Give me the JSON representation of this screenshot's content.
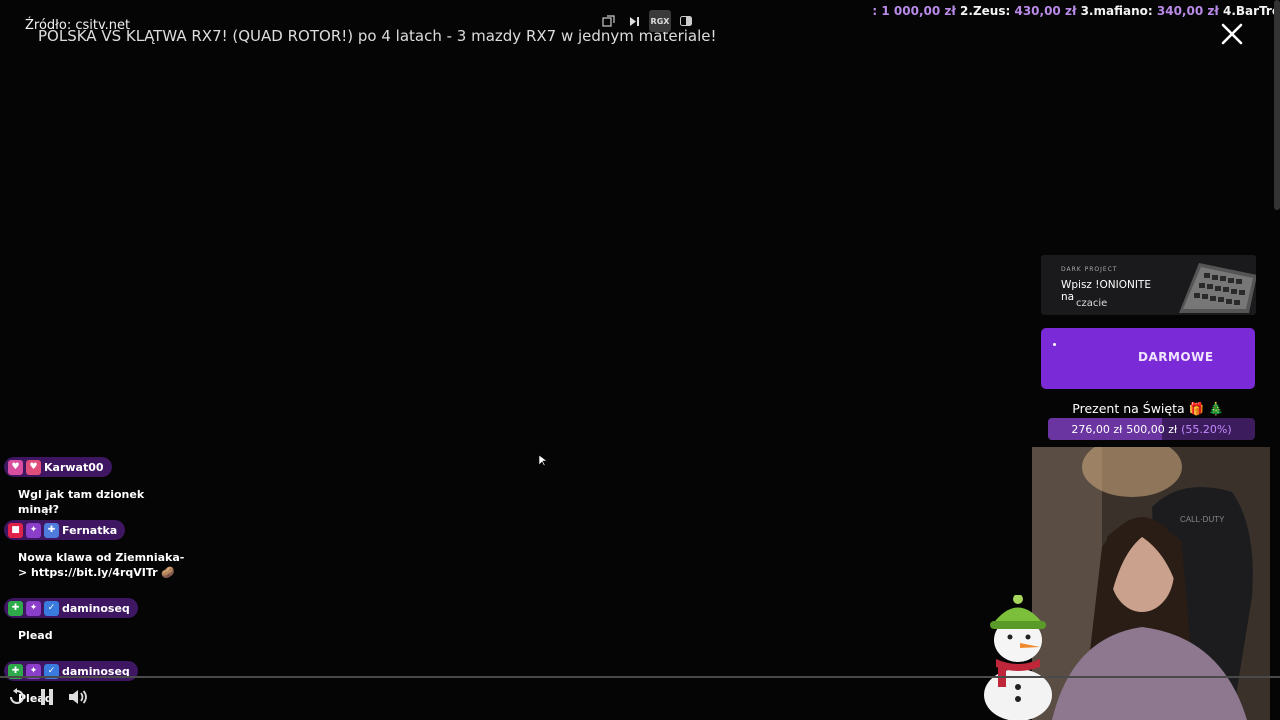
{
  "header": {
    "source_label": "Źródło:",
    "source_value": "csitv.net",
    "video_title": "POLSKA VS KLĄTWA RX7! (QUAD ROTOR!) po 4 latach - 3 mazdy RX7 w jednym materiale!"
  },
  "top_controls": [
    "popout-icon",
    "next-icon",
    "rgx-label",
    "sidebar-icon"
  ],
  "top_controls_rgx": "RGX",
  "ranking": {
    "entries": [
      {
        "rank": "",
        "name": "",
        "amount": ": 1 000,00 zł"
      },
      {
        "rank": "2.",
        "name": "Zeus:",
        "amount": "430,00 zł"
      },
      {
        "rank": "3.",
        "name": "mafiano:",
        "amount": "340,00 zł"
      },
      {
        "rank": "4.",
        "name": "BarTre",
        "amount": ""
      }
    ]
  },
  "ad": {
    "brand": "DARK PROJECT",
    "line1": "Wpisz !ONIONITE na",
    "line2": "czacie"
  },
  "promo": {
    "text": "DARMOWE"
  },
  "goal": {
    "title": "Prezent na Święta 🎁 🎄",
    "current": "276,00 zł",
    "target": "500,00 zł",
    "percent_label": "(55.20%)",
    "fraction": 0.552,
    "colors": {
      "fill": "#6a34a1",
      "track": "#3d1c5e",
      "percent": "#c38cff"
    }
  },
  "chat": [
    {
      "user": "Karwat00",
      "badges": [
        "heart-icon",
        "heart-badge-icon"
      ],
      "message": "Wgl jak tam dzionek minął?"
    },
    {
      "user": "Fernatka",
      "badges": [
        "camera-icon",
        "wings-icon",
        "gift-icon"
      ],
      "message": "Nowa klawa od Ziemniaka-> https://bit.ly/4rqVITr 🥔"
    },
    {
      "user": "daminoseq",
      "badges": [
        "puzzle-icon",
        "wings-icon",
        "verified-icon"
      ],
      "message": "Plead"
    },
    {
      "user": "daminoseq",
      "badges": [
        "puzzle-icon",
        "wings-icon",
        "verified-icon"
      ],
      "message": "Plead"
    }
  ],
  "player": {
    "controls": [
      "replay-icon",
      "pause-icon",
      "volume-icon"
    ]
  },
  "colors": {
    "accent": "#7b2ad8",
    "chat_pill": "#3e1661",
    "background": "#050505"
  }
}
